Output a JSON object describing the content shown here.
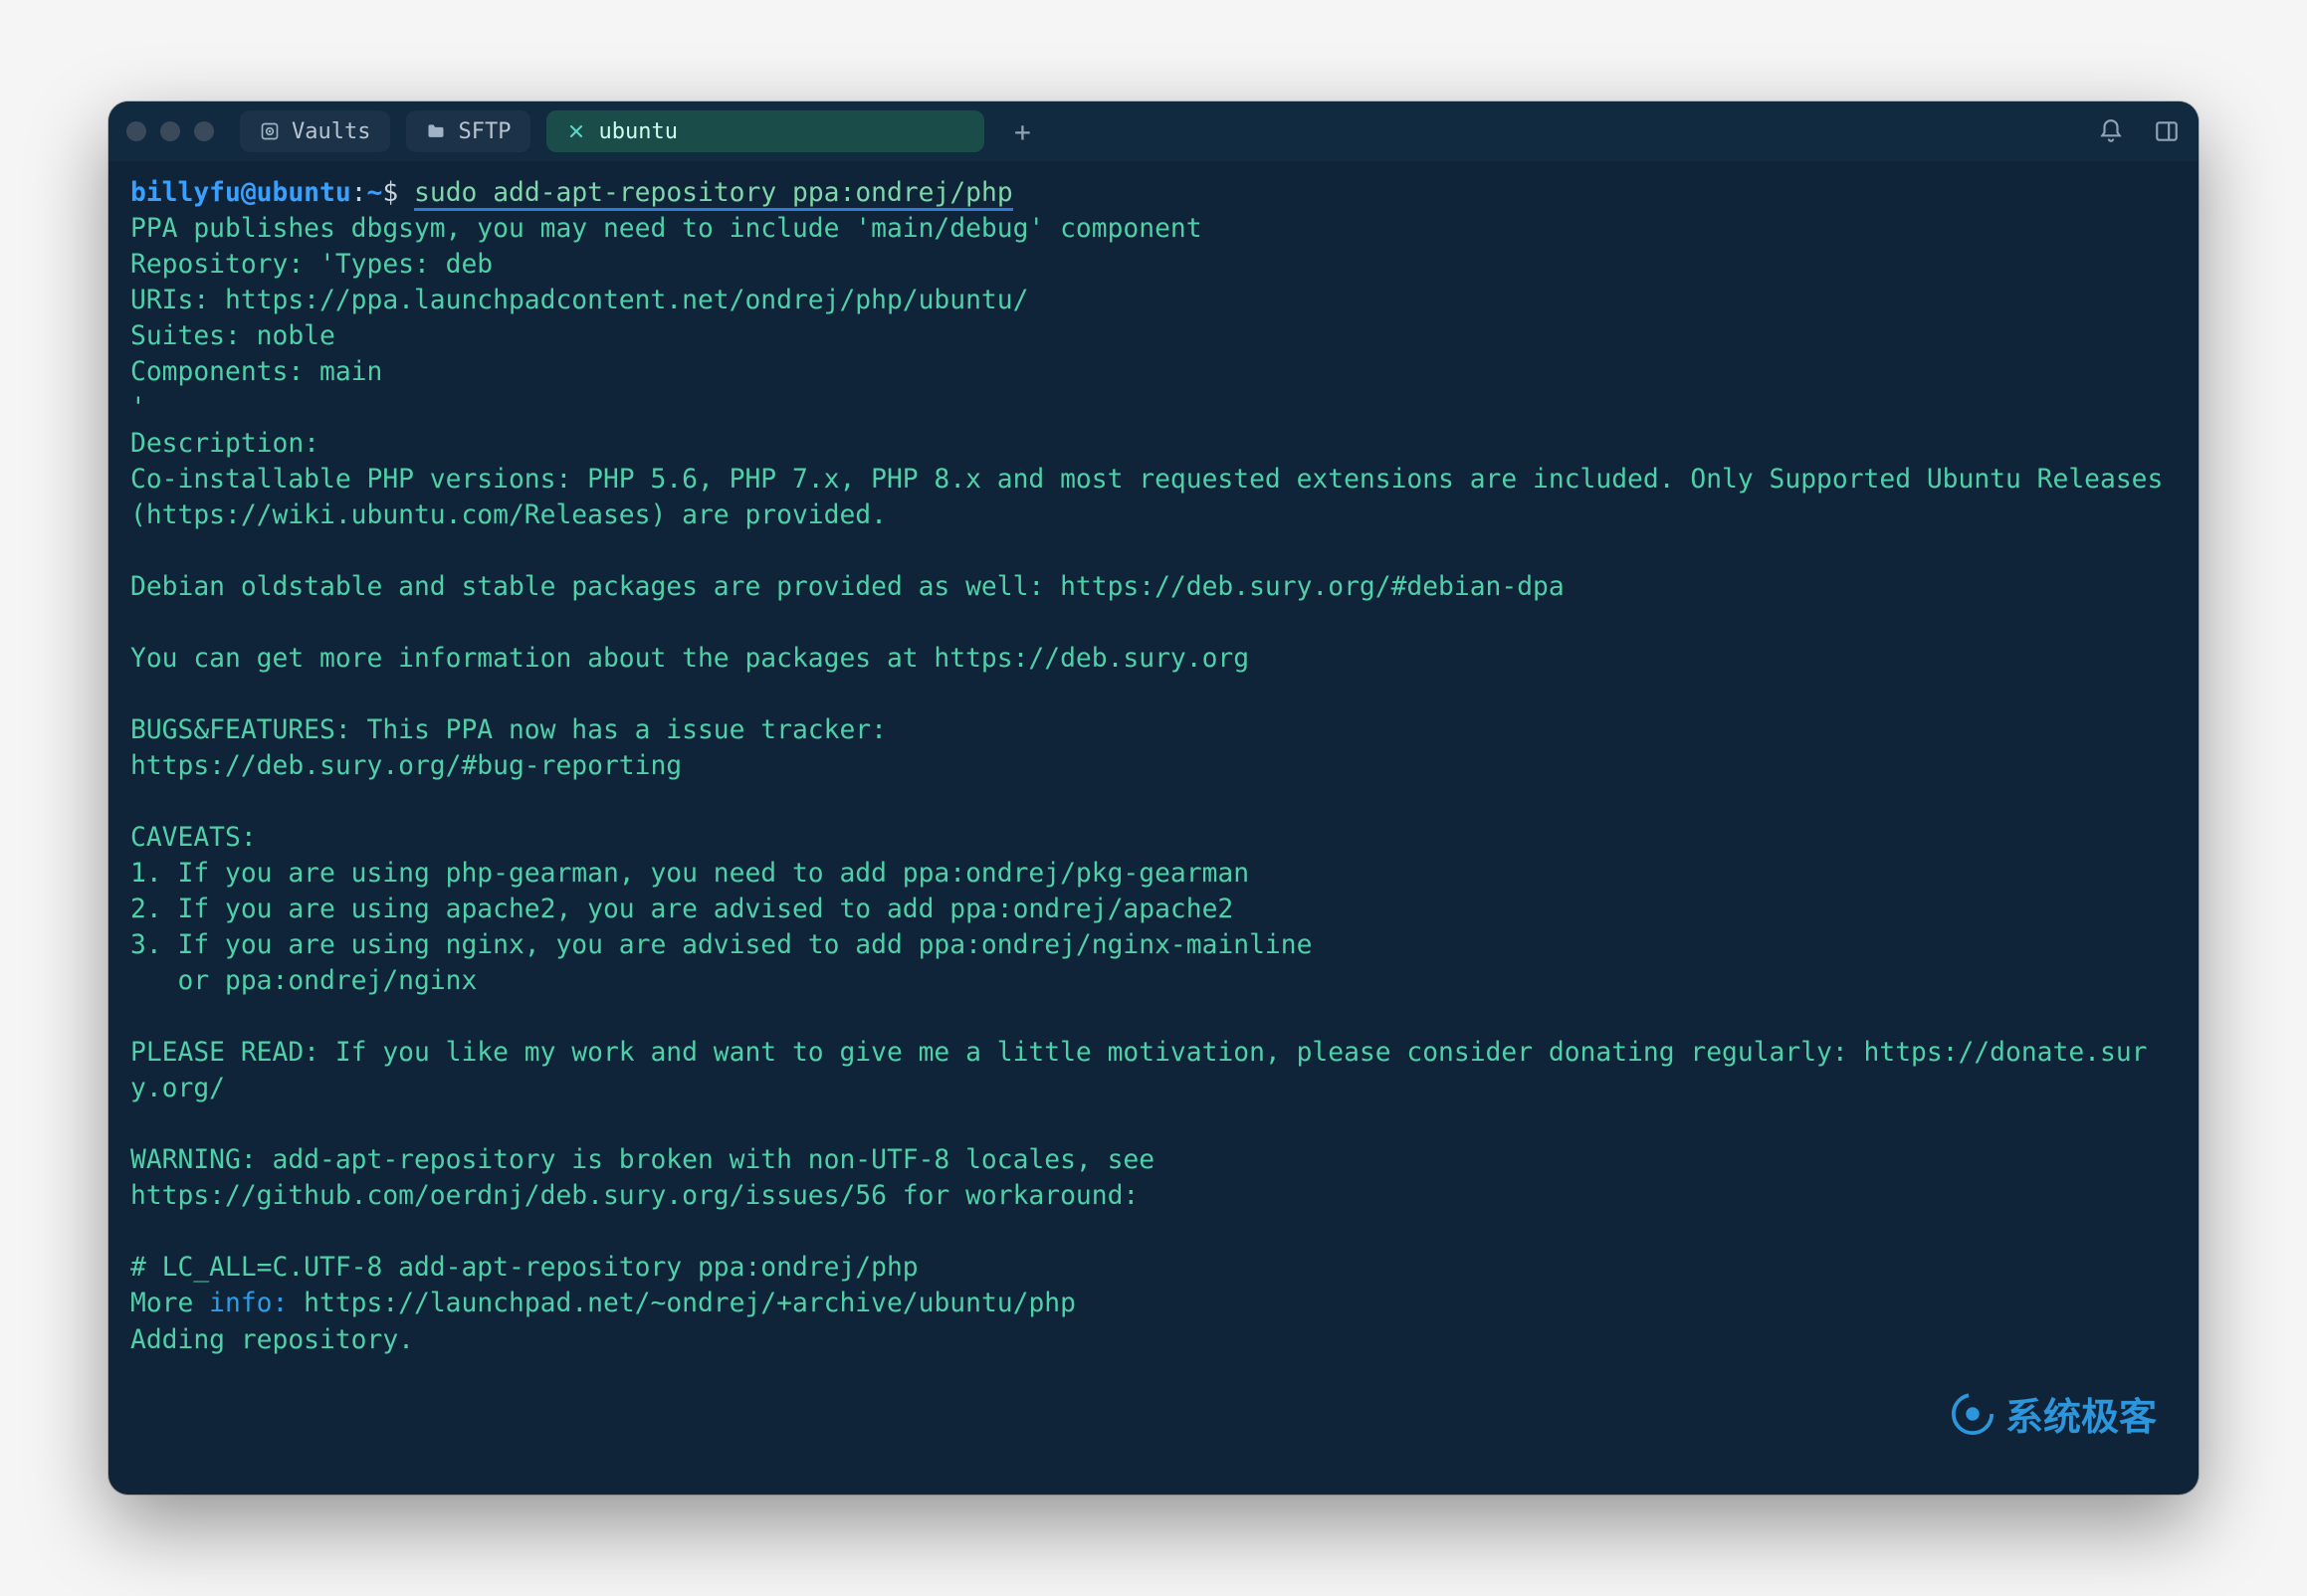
{
  "tabs": {
    "vaults": {
      "label": "Vaults"
    },
    "sftp": {
      "label": "SFTP"
    },
    "active": {
      "label": "ubuntu"
    }
  },
  "prompt": {
    "user_host": "billyfu@ubuntu",
    "sep": ":",
    "path": "~",
    "symbol": "$",
    "command": "sudo add-apt-repository ppa:ondrej/php"
  },
  "output": {
    "l01": "PPA publishes dbgsym, you may need to include 'main/debug' component",
    "l02": "Repository: 'Types: deb",
    "l03": "URIs: https://ppa.launchpadcontent.net/ondrej/php/ubuntu/",
    "l04": "Suites: noble",
    "l05": "Components: main",
    "l06": "'",
    "l07": "Description:",
    "l08": "Co-installable PHP versions: PHP 5.6, PHP 7.x, PHP 8.x and most requested extensions are included. Only Supported Ubuntu Releases (https://wiki.ubuntu.com/Releases) are provided.",
    "l09": "",
    "l10": "Debian oldstable and stable packages are provided as well: https://deb.sury.org/#debian-dpa",
    "l11": "",
    "l12": "You can get more information about the packages at https://deb.sury.org",
    "l13": "",
    "l14": "BUGS&FEATURES: This PPA now has a issue tracker:",
    "l15": "https://deb.sury.org/#bug-reporting",
    "l16": "",
    "l17": "CAVEATS:",
    "l18": "1. If you are using php-gearman, you need to add ppa:ondrej/pkg-gearman",
    "l19": "2. If you are using apache2, you are advised to add ppa:ondrej/apache2",
    "l20": "3. If you are using nginx, you are advised to add ppa:ondrej/nginx-mainline",
    "l21": "   or ppa:ondrej/nginx",
    "l22": "",
    "l23": "PLEASE READ: If you like my work and want to give me a little motivation, please consider donating regularly: https://donate.sury.org/",
    "l24": "",
    "l25": "WARNING: add-apt-repository is broken with non-UTF-8 locales, see",
    "l26": "https://github.com/oerdnj/deb.sury.org/issues/56 for workaround:",
    "l27": "",
    "l28": "# LC_ALL=C.UTF-8 add-apt-repository ppa:ondrej/php",
    "more_prefix": "More ",
    "more_kw": "info:",
    "more_rest": " https://launchpad.net/~ondrej/+archive/ubuntu/php",
    "l30": "Adding repository."
  },
  "watermark": "系统极客"
}
